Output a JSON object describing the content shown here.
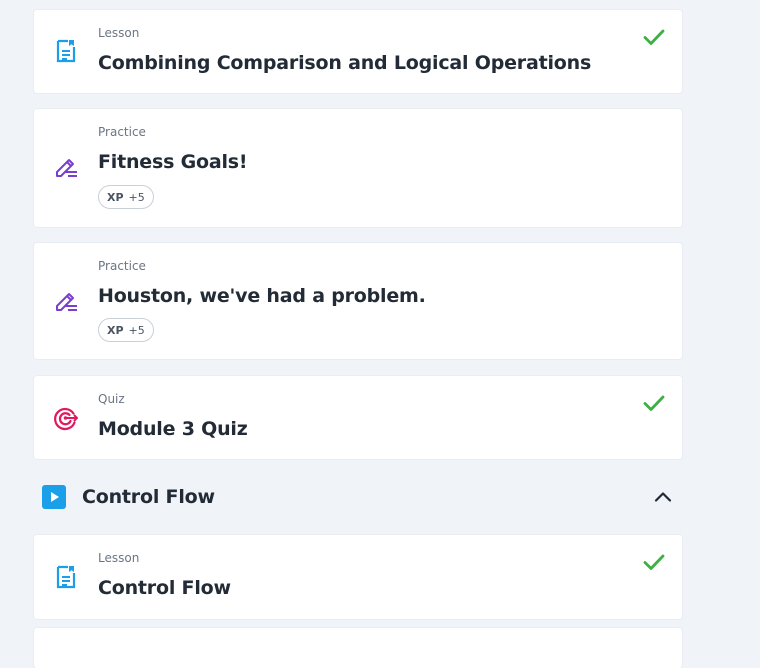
{
  "items": [
    {
      "kind": "Lesson",
      "title": "Combining Comparison and Logical Operations",
      "icon": "lesson-doc-icon",
      "completed": true
    },
    {
      "kind": "Practice",
      "title": "Fitness Goals!",
      "icon": "practice-pencil-icon",
      "completed": false,
      "xp_label": "XP",
      "xp_value": "+5"
    },
    {
      "kind": "Practice",
      "title": "Houston, we've had a problem.",
      "icon": "practice-pencil-icon",
      "completed": false,
      "xp_label": "XP",
      "xp_value": "+5"
    },
    {
      "kind": "Quiz",
      "title": "Module 3 Quiz",
      "icon": "quiz-target-icon",
      "completed": true
    }
  ],
  "section": {
    "title": "Control Flow",
    "icon": "play-icon",
    "expanded": true
  },
  "section_items": [
    {
      "kind": "Lesson",
      "title": "Control Flow",
      "icon": "lesson-doc-icon",
      "completed": true
    }
  ],
  "colors": {
    "background": "#f0f3f7",
    "lesson_icon": "#1a9fe8",
    "practice_icon": "#7b3fd0",
    "quiz_icon": "#e0195f",
    "check": "#3cb043",
    "section_icon": "#1a9fe8"
  }
}
